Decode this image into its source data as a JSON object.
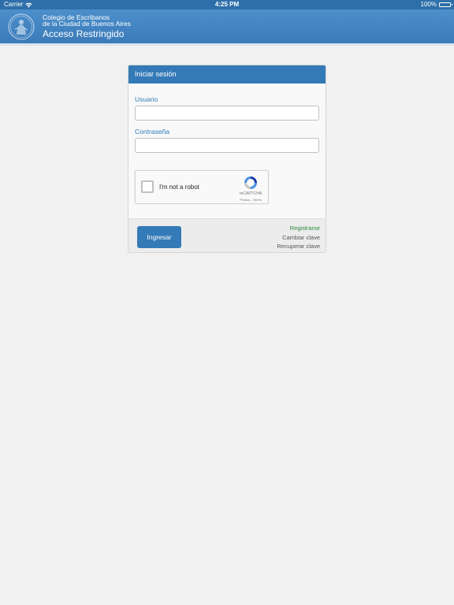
{
  "status_bar": {
    "carrier": "Carrier",
    "time": "4:25 PM",
    "battery": "100%",
    "battery_level": 1.0
  },
  "header": {
    "subtitle_line1": "Colegio de Escribanos",
    "subtitle_line2": "de la Ciudad de Buenos Aires",
    "title": "Acceso Restringido"
  },
  "login": {
    "heading": "Iniciar sesión",
    "username_label": "Usuario",
    "username_value": "",
    "password_label": "Contraseña",
    "password_value": "",
    "submit_label": "Ingresar"
  },
  "recaptcha": {
    "label": "I'm not a robot",
    "brand": "reCAPTCHA",
    "links": "Privacy - Terms"
  },
  "links": {
    "register": "Registrarse",
    "change_password": "Cambiar clave",
    "recover_password": "Recuperar clave"
  },
  "colors": {
    "header": "#3a7ab9",
    "primary": "#347ab7",
    "label": "#2d7ab8",
    "register_link": "#2a8a3a",
    "background": "#f1f1f1"
  }
}
